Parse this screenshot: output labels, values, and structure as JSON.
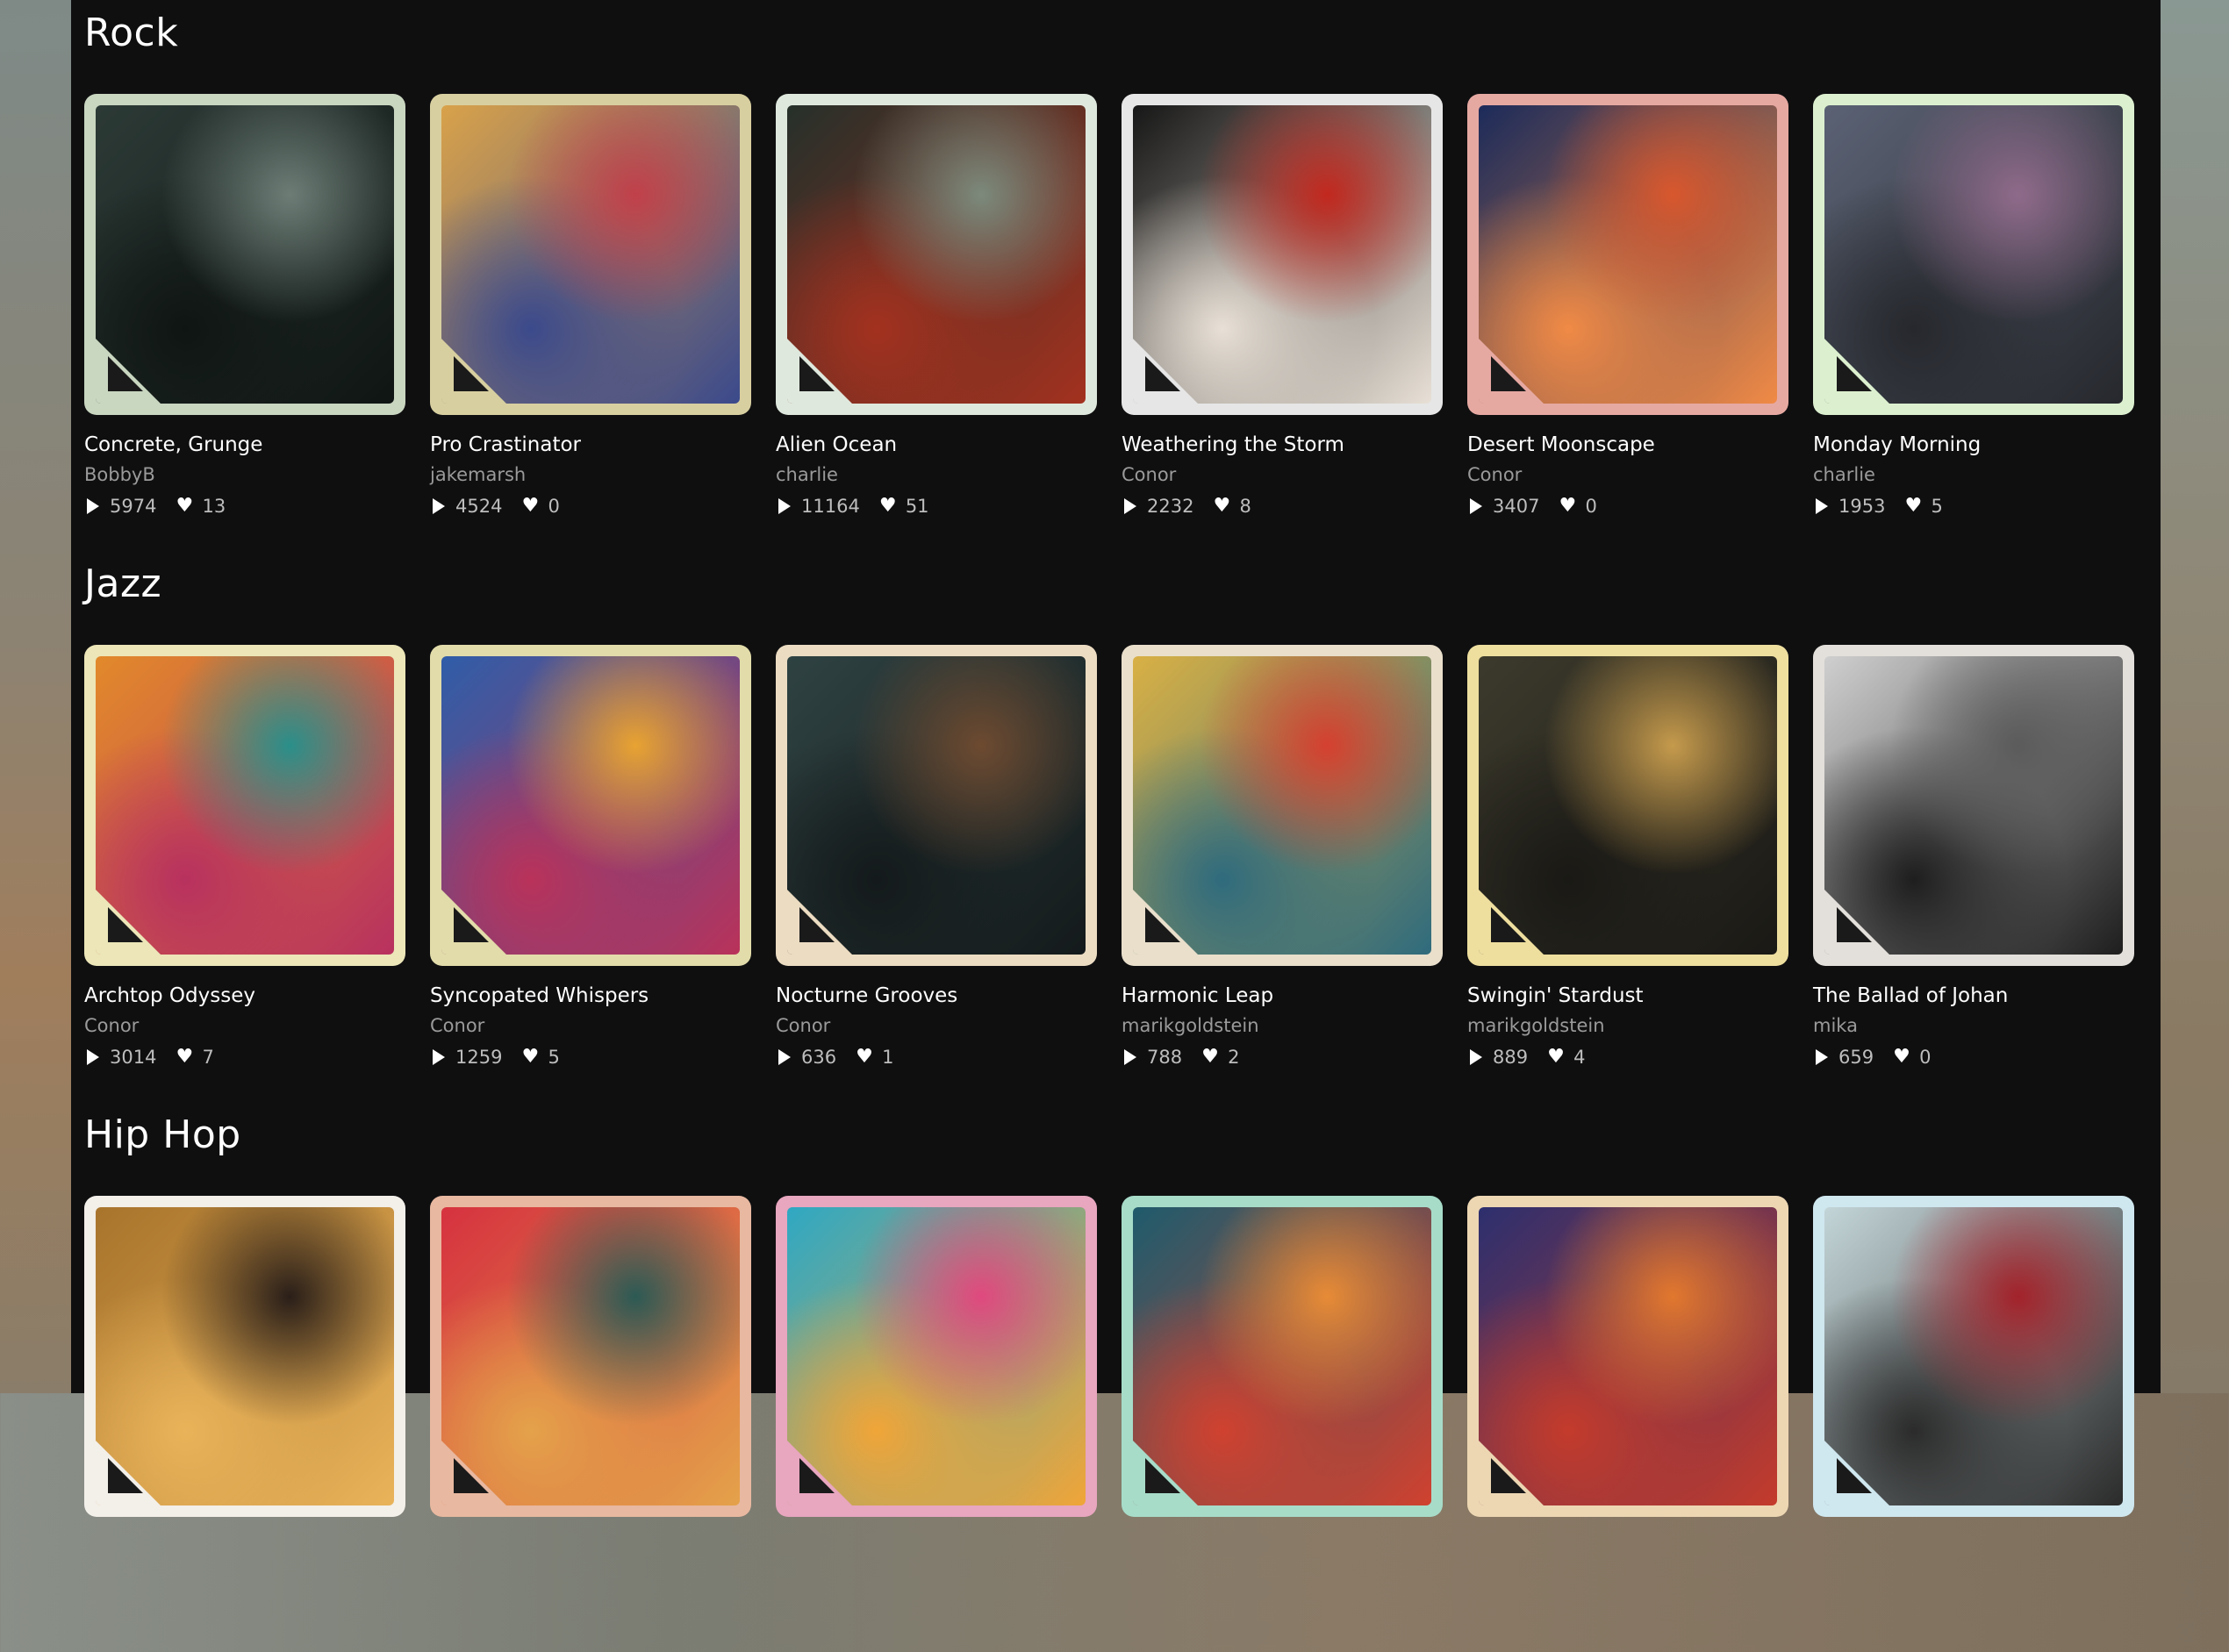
{
  "sections": [
    {
      "title": "Rock",
      "cards": [
        {
          "title": "Concrete, Grunge",
          "artist": "BobbyB",
          "plays": "5974",
          "likes": "13",
          "frame": "#c9d6c0",
          "art_a": "#2c3a36",
          "art_b": "#6d7d76",
          "art_c": "#0f1513"
        },
        {
          "title": "Pro Crastinator",
          "artist": "jakemarsh",
          "plays": "4524",
          "likes": "0",
          "frame": "#d8cfa0",
          "art_a": "#d9a24a",
          "art_b": "#c1404a",
          "art_c": "#3b4a8c"
        },
        {
          "title": "Alien Ocean",
          "artist": "charlie",
          "plays": "11164",
          "likes": "51",
          "frame": "#dfe8dd",
          "art_a": "#26302a",
          "art_b": "#7c8a7c",
          "art_c": "#a3311f"
        },
        {
          "title": "Weathering the Storm",
          "artist": "Conor",
          "plays": "2232",
          "likes": "8",
          "frame": "#e6e6e6",
          "art_a": "#171717",
          "art_b": "#c2281e",
          "art_c": "#e8e0d6"
        },
        {
          "title": "Desert Moonscape",
          "artist": "Conor",
          "plays": "3407",
          "likes": "0",
          "frame": "#e6a9a2",
          "art_a": "#1c2b5a",
          "art_b": "#d8572d",
          "art_c": "#f08a46"
        },
        {
          "title": "Monday Morning",
          "artist": "charlie",
          "plays": "1953",
          "likes": "5",
          "frame": "#dcf0cf",
          "art_a": "#5b6274",
          "art_b": "#8f6a8a",
          "art_c": "#26282d"
        }
      ]
    },
    {
      "title": "Jazz",
      "cards": [
        {
          "title": "Archtop Odyssey",
          "artist": "Conor",
          "plays": "3014",
          "likes": "7",
          "frame": "#ece6b8",
          "art_a": "#e2892b",
          "art_b": "#2a8f8a",
          "art_c": "#b8315f"
        },
        {
          "title": "Syncopated Whispers",
          "artist": "Conor",
          "plays": "1259",
          "likes": "5",
          "frame": "#e2dcaa",
          "art_a": "#2f5da8",
          "art_b": "#e8a331",
          "art_c": "#b9325a"
        },
        {
          "title": "Nocturne Grooves",
          "artist": "Conor",
          "plays": "636",
          "likes": "1",
          "frame": "#ecdcc2",
          "art_a": "#2f4242",
          "art_b": "#6d4a30",
          "art_c": "#141a1b"
        },
        {
          "title": "Harmonic Leap",
          "artist": "marikgoldstein",
          "plays": "788",
          "likes": "2",
          "frame": "#e9dfcb",
          "art_a": "#d9b045",
          "art_b": "#d5402f",
          "art_c": "#2f6b7d"
        },
        {
          "title": "Swingin' Stardust",
          "artist": "marikgoldstein",
          "plays": "889",
          "likes": "4",
          "frame": "#eedf9f",
          "art_a": "#3c3a2c",
          "art_b": "#c59a4c",
          "art_c": "#1a1915"
        },
        {
          "title": "The Ballad of Johan",
          "artist": "mika",
          "plays": "659",
          "likes": "0",
          "frame": "#e3dfda",
          "art_a": "#cfcfcf",
          "art_b": "#5b5b5b",
          "art_c": "#1e1e1e"
        }
      ]
    },
    {
      "title": "Hip Hop",
      "cards": [
        {
          "title": "",
          "artist": "",
          "plays": "",
          "likes": "",
          "frame": "#f3efe9",
          "art_a": "#a8742c",
          "art_b": "#2a1f19",
          "art_c": "#e9b35a"
        },
        {
          "title": "",
          "artist": "",
          "plays": "",
          "likes": "",
          "frame": "#e8b8a0",
          "art_a": "#d6323f",
          "art_b": "#2c5a54",
          "art_c": "#e4a24a"
        },
        {
          "title": "",
          "artist": "",
          "plays": "",
          "likes": "",
          "frame": "#e8a6bf",
          "art_a": "#2fa8c3",
          "art_b": "#e0497e",
          "art_c": "#f0a538"
        },
        {
          "title": "",
          "artist": "",
          "plays": "",
          "likes": "",
          "frame": "#a7dcc9",
          "art_a": "#1f5b6c",
          "art_b": "#e78b36",
          "art_c": "#d0412f"
        },
        {
          "title": "",
          "artist": "",
          "plays": "",
          "likes": "",
          "frame": "#edd7b3",
          "art_a": "#2d2f6e",
          "art_b": "#e2782e",
          "art_c": "#c43b2b"
        },
        {
          "title": "",
          "artist": "",
          "plays": "",
          "likes": "",
          "frame": "#cfe7ef",
          "art_a": "#c3d5d8",
          "art_b": "#a3222a",
          "art_c": "#2b2b2b"
        }
      ]
    }
  ]
}
